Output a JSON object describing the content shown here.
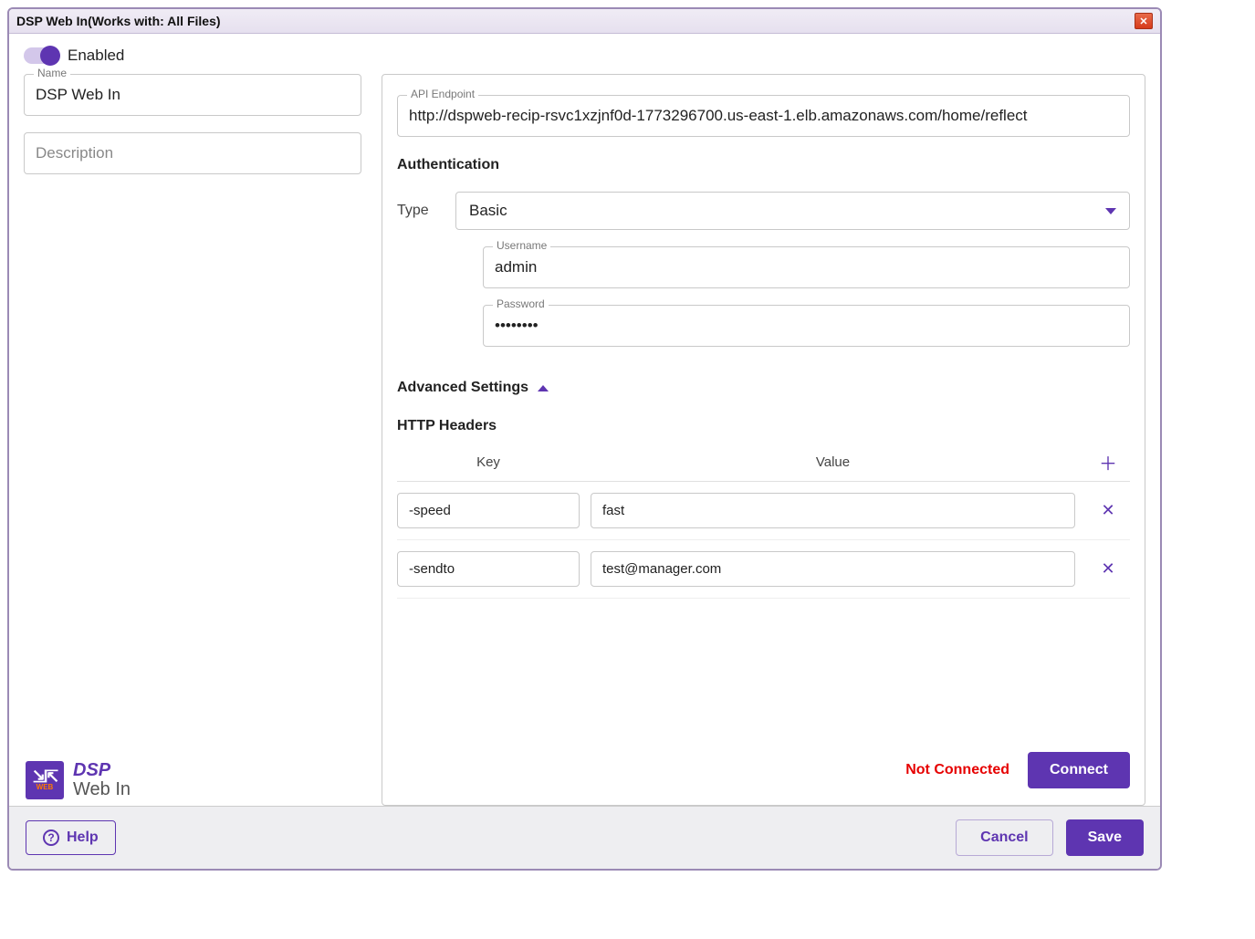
{
  "window": {
    "title_main": "DSP Web In",
    "title_suffix": "  (Works with: All Files)"
  },
  "enabled": {
    "value": true,
    "label": "Enabled"
  },
  "left": {
    "name_label": "Name",
    "name_value": "DSP Web In",
    "description_placeholder": "Description",
    "description_value": ""
  },
  "settings": {
    "api_endpoint_label": "API Endpoint",
    "api_endpoint_value": "http://dspweb-recip-rsvc1xzjnf0d-1773296700.us-east-1.elb.amazonaws.com/home/reflect",
    "auth_section": "Authentication",
    "type_label": "Type",
    "type_value": "Basic",
    "username_label": "Username",
    "username_value": "admin",
    "password_label": "Password",
    "password_value": "••••••••",
    "advanced_label": "Advanced Settings",
    "http_headers_label": "HTTP Headers",
    "headers": {
      "col_key": "Key",
      "col_value": "Value",
      "rows": [
        {
          "key": "-speed",
          "value": "fast"
        },
        {
          "key": "-sendto",
          "value": "test@manager.com"
        }
      ]
    },
    "status": "Not Connected",
    "connect_label": "Connect"
  },
  "brand": {
    "line1": "DSP",
    "line2": "Web In",
    "badge_label": "WEB"
  },
  "footer": {
    "help": "Help",
    "cancel": "Cancel",
    "save": "Save"
  }
}
